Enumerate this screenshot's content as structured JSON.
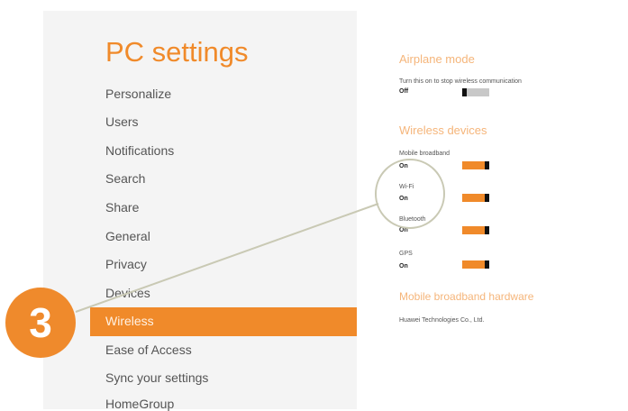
{
  "title": "PC settings",
  "nav": {
    "items": [
      {
        "label": "Personalize"
      },
      {
        "label": "Users"
      },
      {
        "label": "Notifications"
      },
      {
        "label": "Search"
      },
      {
        "label": "Share"
      },
      {
        "label": "General"
      },
      {
        "label": "Privacy"
      },
      {
        "label": "Devices"
      },
      {
        "label": "Wireless",
        "selected": true
      },
      {
        "label": "Ease of Access"
      },
      {
        "label": "Sync your settings"
      },
      {
        "label": "HomeGroup"
      }
    ]
  },
  "airplane": {
    "heading": "Airplane mode",
    "description": "Turn this on to stop wireless communication",
    "state": "Off"
  },
  "wireless_devices": {
    "heading": "Wireless devices",
    "devices": [
      {
        "name": "Mobile broadband",
        "state": "On"
      },
      {
        "name": "Wi-Fi",
        "state": "On"
      },
      {
        "name": "Bluetooth",
        "state": "On"
      },
      {
        "name": "GPS",
        "state": "On"
      }
    ]
  },
  "hardware": {
    "heading": "Mobile broadband hardware",
    "vendor": "Huawei Technologies Co., Ltd."
  },
  "callout": {
    "number": "3"
  },
  "colors": {
    "accent": "#f08a2a",
    "heading": "#f5b57a",
    "toggle_off": "#c8c8c8",
    "left_panel_bg": "#f4f4f4"
  }
}
